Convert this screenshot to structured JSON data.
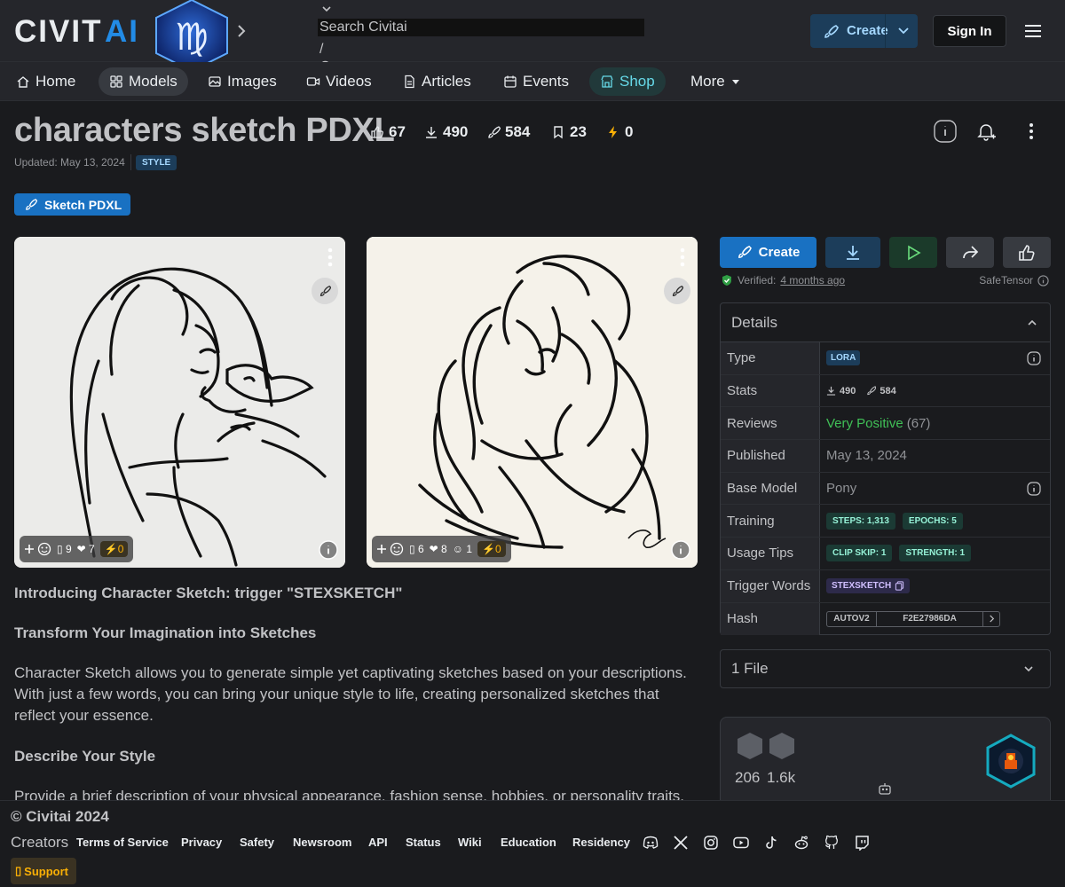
{
  "header": {
    "logo_text": "CIVITAI",
    "search_placeholder": "Search Civitai",
    "search_shortcut": "/",
    "create_label": "Create",
    "signin_label": "Sign In"
  },
  "nav": {
    "items": [
      {
        "label": "Home"
      },
      {
        "label": "Models"
      },
      {
        "label": "Images"
      },
      {
        "label": "Videos"
      },
      {
        "label": "Articles"
      },
      {
        "label": "Events"
      },
      {
        "label": "Shop"
      },
      {
        "label": "More"
      }
    ]
  },
  "model": {
    "title": "characters sketch PDXL",
    "stats": {
      "likes": "67",
      "downloads": "490",
      "generations": "584",
      "bookmarks": "23",
      "buzz": "0"
    },
    "updated": "Updated: May 13, 2024",
    "type_badge": "STYLE",
    "version_label": "Sketch PDXL"
  },
  "gallery": [
    {
      "reactions": {
        "comments": "9",
        "hearts": "7",
        "buzz": "0"
      }
    },
    {
      "reactions": {
        "comments": "6",
        "hearts": "8",
        "laughs": "1",
        "buzz": "0"
      }
    }
  ],
  "description": {
    "h1": "Introducing Character Sketch: trigger \"STEXSKETCH\"",
    "h2": "Transform Your Imagination into Sketches",
    "p1": "Character Sketch allows you to generate simple yet captivating sketches based on your descriptions. With just a few words, you can bring your unique style to life, creating personalized sketches that reflect your essence.",
    "h3": "Describe Your Style",
    "p2": "Provide a brief description of your physical appearance, fashion sense, hobbies, or personality traits."
  },
  "actions": {
    "create_label": "Create"
  },
  "verification": {
    "label": "Verified:",
    "when": "4 months ago",
    "format": "SafeTensor"
  },
  "details": {
    "header": "Details",
    "rows": {
      "type": {
        "label": "Type",
        "value": "LORA"
      },
      "stats": {
        "label": "Stats",
        "downloads": "490",
        "generations": "584"
      },
      "reviews": {
        "label": "Reviews",
        "sentiment": "Very Positive",
        "count": "(67)"
      },
      "published": {
        "label": "Published",
        "value": "May 13, 2024"
      },
      "base_model": {
        "label": "Base Model",
        "value": "Pony"
      },
      "training": {
        "label": "Training",
        "steps": "STEPS: 1,313",
        "epochs": "EPOCHS: 5"
      },
      "usage": {
        "label": "Usage Tips",
        "clip": "CLIP SKIP: 1",
        "strength": "STRENGTH: 1"
      },
      "trigger": {
        "label": "Trigger Words",
        "value": "STEXSKETCH"
      },
      "hash": {
        "label": "Hash",
        "algo": "AUTOV2",
        "value": "F2E27986DA"
      }
    }
  },
  "files": {
    "label": "1 File"
  },
  "creator": {
    "stat1": "206",
    "stat2": "1.6k"
  },
  "footer": {
    "copyright": "© Civitai 2024",
    "creators": "Creators",
    "links": [
      "Terms of Service",
      "Privacy",
      "Safety",
      "Newsroom",
      "API",
      "Status",
      "Wiki",
      "Education",
      "Residency"
    ],
    "support": "Support"
  },
  "colors": {
    "accent": "#1971c2",
    "verified": "#40c057",
    "positive": "#40c057",
    "buzz": "#fab005",
    "shop": "#66d9e8"
  }
}
